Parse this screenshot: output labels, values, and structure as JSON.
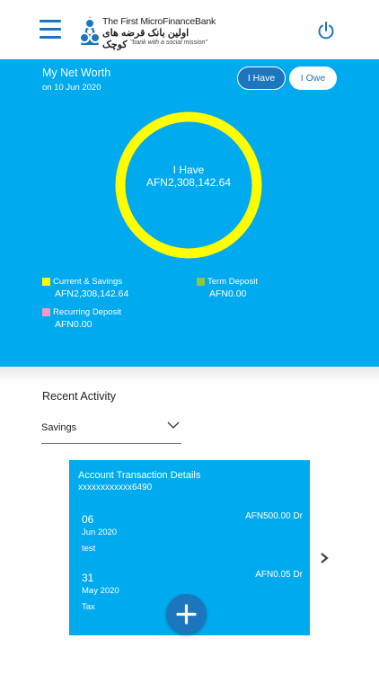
{
  "header": {
    "brand_en": "The First MicroFinanceBank",
    "brand_fa": "اولین بانک قرضه های کوچک",
    "tagline": "\"bank with a social mission\""
  },
  "networth": {
    "title": "My Net Worth",
    "date": "on 10 Jun 2020",
    "toggle_have": "I Have",
    "toggle_owe": "I Owe",
    "ring_label": "I Have",
    "ring_value": "AFN2,308,142.64",
    "legend": [
      {
        "label": "Current & Savings",
        "value": "AFN2,308,142.64",
        "color": "#ffff00"
      },
      {
        "label": "Term Deposit",
        "value": "AFN0.00",
        "color": "#8dc63f"
      },
      {
        "label": "Recurring Deposit",
        "value": "AFN0.00",
        "color": "#f49ac2"
      }
    ]
  },
  "recent": {
    "title": "Recent Activity",
    "selected": "Savings"
  },
  "card": {
    "title": "Account Transaction Details",
    "account": "xxxxxxxxxxxx6490",
    "transactions": [
      {
        "day": "06",
        "month": "Jun 2020",
        "desc": "test",
        "amount": "AFN500.00 Dr"
      },
      {
        "day": "31",
        "month": "May 2020",
        "desc": "Tax",
        "amount": "AFN0.05 Dr"
      }
    ]
  },
  "colors": {
    "primary": "#00aaef",
    "dark_blue": "#1b76bd",
    "ring": "#ffff00"
  },
  "icons": {
    "menu": "hamburger-icon",
    "power": "power-icon",
    "dropdown": "chevron-down-icon",
    "next": "chevron-right-icon",
    "add": "plus-icon"
  }
}
